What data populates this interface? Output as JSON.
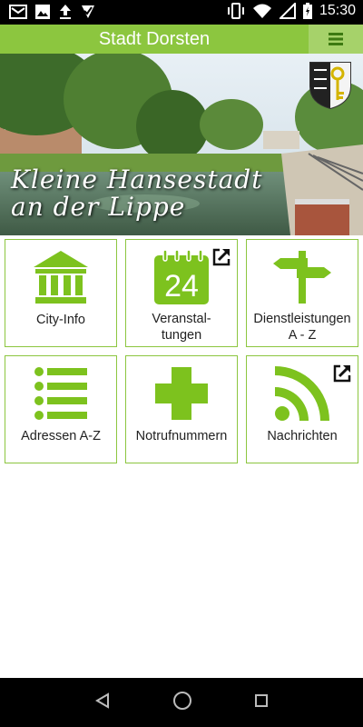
{
  "status_bar": {
    "time": "15:30",
    "left_icons": [
      "mail-icon",
      "image-icon",
      "upload-icon",
      "check-download-icon"
    ],
    "right_icons": [
      "vibrate-icon",
      "wifi-icon",
      "signal-icon",
      "battery-icon"
    ]
  },
  "app_bar": {
    "title": "Stadt Dorsten",
    "menu_icon": "hamburger-menu-icon",
    "color": "#8cc63f"
  },
  "hero": {
    "line1": "Kleine Hansestadt",
    "line2": "an der Lippe"
  },
  "tiles": [
    {
      "label": "City-Info",
      "icon": "city-hall-icon",
      "external": false
    },
    {
      "label": "Veranstal-\ntungen",
      "icon": "calendar-24-icon",
      "external": true
    },
    {
      "label": "Dienstleistungen\nA - Z",
      "icon": "signpost-icon",
      "external": false
    },
    {
      "label": "Adressen A-Z",
      "icon": "list-icon",
      "external": false
    },
    {
      "label": "Notrufnummern",
      "icon": "medical-cross-icon",
      "external": false
    },
    {
      "label": "Nachrichten",
      "icon": "rss-icon",
      "external": true
    }
  ],
  "calendar_day": "24",
  "nav_bar": [
    "back-icon",
    "home-icon",
    "recents-icon"
  ]
}
